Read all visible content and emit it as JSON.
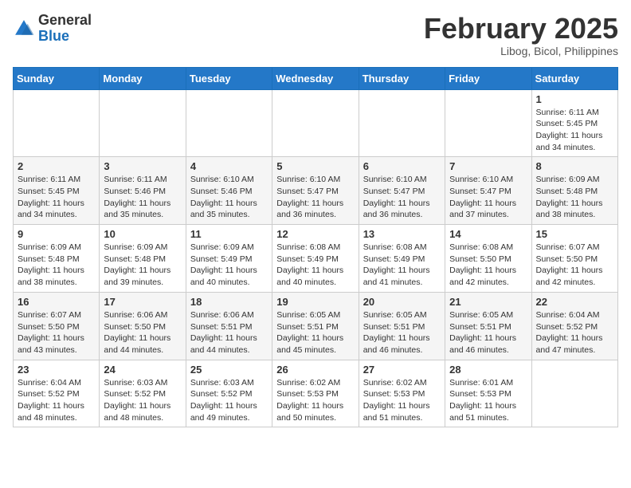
{
  "header": {
    "logo_general": "General",
    "logo_blue": "Blue",
    "month_title": "February 2025",
    "location": "Libog, Bicol, Philippines"
  },
  "weekdays": [
    "Sunday",
    "Monday",
    "Tuesday",
    "Wednesday",
    "Thursday",
    "Friday",
    "Saturday"
  ],
  "weeks": [
    [
      {
        "day": "",
        "info": ""
      },
      {
        "day": "",
        "info": ""
      },
      {
        "day": "",
        "info": ""
      },
      {
        "day": "",
        "info": ""
      },
      {
        "day": "",
        "info": ""
      },
      {
        "day": "",
        "info": ""
      },
      {
        "day": "1",
        "info": "Sunrise: 6:11 AM\nSunset: 5:45 PM\nDaylight: 11 hours\nand 34 minutes."
      }
    ],
    [
      {
        "day": "2",
        "info": "Sunrise: 6:11 AM\nSunset: 5:45 PM\nDaylight: 11 hours\nand 34 minutes."
      },
      {
        "day": "3",
        "info": "Sunrise: 6:11 AM\nSunset: 5:46 PM\nDaylight: 11 hours\nand 35 minutes."
      },
      {
        "day": "4",
        "info": "Sunrise: 6:10 AM\nSunset: 5:46 PM\nDaylight: 11 hours\nand 35 minutes."
      },
      {
        "day": "5",
        "info": "Sunrise: 6:10 AM\nSunset: 5:47 PM\nDaylight: 11 hours\nand 36 minutes."
      },
      {
        "day": "6",
        "info": "Sunrise: 6:10 AM\nSunset: 5:47 PM\nDaylight: 11 hours\nand 36 minutes."
      },
      {
        "day": "7",
        "info": "Sunrise: 6:10 AM\nSunset: 5:47 PM\nDaylight: 11 hours\nand 37 minutes."
      },
      {
        "day": "8",
        "info": "Sunrise: 6:09 AM\nSunset: 5:48 PM\nDaylight: 11 hours\nand 38 minutes."
      }
    ],
    [
      {
        "day": "9",
        "info": "Sunrise: 6:09 AM\nSunset: 5:48 PM\nDaylight: 11 hours\nand 38 minutes."
      },
      {
        "day": "10",
        "info": "Sunrise: 6:09 AM\nSunset: 5:48 PM\nDaylight: 11 hours\nand 39 minutes."
      },
      {
        "day": "11",
        "info": "Sunrise: 6:09 AM\nSunset: 5:49 PM\nDaylight: 11 hours\nand 40 minutes."
      },
      {
        "day": "12",
        "info": "Sunrise: 6:08 AM\nSunset: 5:49 PM\nDaylight: 11 hours\nand 40 minutes."
      },
      {
        "day": "13",
        "info": "Sunrise: 6:08 AM\nSunset: 5:49 PM\nDaylight: 11 hours\nand 41 minutes."
      },
      {
        "day": "14",
        "info": "Sunrise: 6:08 AM\nSunset: 5:50 PM\nDaylight: 11 hours\nand 42 minutes."
      },
      {
        "day": "15",
        "info": "Sunrise: 6:07 AM\nSunset: 5:50 PM\nDaylight: 11 hours\nand 42 minutes."
      }
    ],
    [
      {
        "day": "16",
        "info": "Sunrise: 6:07 AM\nSunset: 5:50 PM\nDaylight: 11 hours\nand 43 minutes."
      },
      {
        "day": "17",
        "info": "Sunrise: 6:06 AM\nSunset: 5:50 PM\nDaylight: 11 hours\nand 44 minutes."
      },
      {
        "day": "18",
        "info": "Sunrise: 6:06 AM\nSunset: 5:51 PM\nDaylight: 11 hours\nand 44 minutes."
      },
      {
        "day": "19",
        "info": "Sunrise: 6:05 AM\nSunset: 5:51 PM\nDaylight: 11 hours\nand 45 minutes."
      },
      {
        "day": "20",
        "info": "Sunrise: 6:05 AM\nSunset: 5:51 PM\nDaylight: 11 hours\nand 46 minutes."
      },
      {
        "day": "21",
        "info": "Sunrise: 6:05 AM\nSunset: 5:51 PM\nDaylight: 11 hours\nand 46 minutes."
      },
      {
        "day": "22",
        "info": "Sunrise: 6:04 AM\nSunset: 5:52 PM\nDaylight: 11 hours\nand 47 minutes."
      }
    ],
    [
      {
        "day": "23",
        "info": "Sunrise: 6:04 AM\nSunset: 5:52 PM\nDaylight: 11 hours\nand 48 minutes."
      },
      {
        "day": "24",
        "info": "Sunrise: 6:03 AM\nSunset: 5:52 PM\nDaylight: 11 hours\nand 48 minutes."
      },
      {
        "day": "25",
        "info": "Sunrise: 6:03 AM\nSunset: 5:52 PM\nDaylight: 11 hours\nand 49 minutes."
      },
      {
        "day": "26",
        "info": "Sunrise: 6:02 AM\nSunset: 5:53 PM\nDaylight: 11 hours\nand 50 minutes."
      },
      {
        "day": "27",
        "info": "Sunrise: 6:02 AM\nSunset: 5:53 PM\nDaylight: 11 hours\nand 51 minutes."
      },
      {
        "day": "28",
        "info": "Sunrise: 6:01 AM\nSunset: 5:53 PM\nDaylight: 11 hours\nand 51 minutes."
      },
      {
        "day": "",
        "info": ""
      }
    ]
  ]
}
